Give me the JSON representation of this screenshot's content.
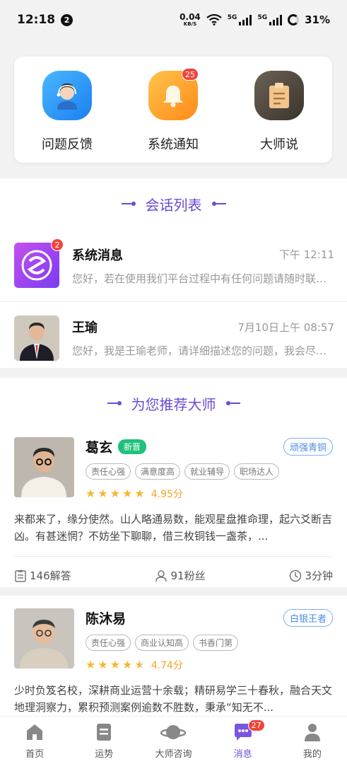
{
  "status_bar": {
    "time": "12:18",
    "notif_count": "2",
    "net_speed_value": "0.04",
    "net_speed_unit": "KB/S",
    "sim1": "5G",
    "sim2": "5G",
    "battery": "31%"
  },
  "quick_actions": [
    {
      "label": "问题反馈",
      "icon": "customer-service-icon"
    },
    {
      "label": "系统通知",
      "icon": "bell-icon",
      "badge": "25"
    },
    {
      "label": "大师说",
      "icon": "clipboard-icon"
    }
  ],
  "conversations": {
    "title": "会话列表",
    "items": [
      {
        "name": "系统消息",
        "time": "下午 12:11",
        "message": "您好，若在使用我们平台过程中有任何问题请随时联系我们",
        "badge": "2"
      },
      {
        "name": "王瑜",
        "time": "7月10日上午 08:57",
        "message": "您好，我是王瑜老师，请详细描述您的问题，我会尽快为您解答"
      }
    ]
  },
  "recommend": {
    "title": "为您推荐大师",
    "masters": [
      {
        "name": "葛玄",
        "new_badge": "新晋",
        "rank": "顽强青铜",
        "tags": [
          "责任心强",
          "满意度高",
          "就业辅导",
          "职场达人"
        ],
        "rating": 4.95,
        "score_text": "4.95分",
        "description": "来都来了，缘分使然。山人略通易数，能观星盘推命理，起六爻断吉凶。有甚迷惘？不妨坐下聊聊，借三枚铜钱一盏茶，...",
        "answers": "146解答",
        "fans": "91粉丝",
        "response": "3分钟"
      },
      {
        "name": "陈沐易",
        "rank": "白银王者",
        "tags": [
          "责任心强",
          "商业认知高",
          "书香门第"
        ],
        "rating": 4.74,
        "score_text": "4.74分",
        "description": "少时负笈名校，深耕商业运营十余载；精研易学三十春秋，融合天文地理洞察力，累积预测案例逾数不胜数，秉承“知无不..."
      }
    ]
  },
  "bottom_nav": [
    {
      "label": "首页",
      "icon": "home-icon"
    },
    {
      "label": "运势",
      "icon": "document-icon"
    },
    {
      "label": "大师咨询",
      "icon": "planet-icon"
    },
    {
      "label": "消息",
      "icon": "message-icon",
      "badge": "27",
      "active": true
    },
    {
      "label": "我的",
      "icon": "profile-icon"
    }
  ],
  "colors": {
    "accent": "#6a4bd6",
    "badge": "#f0453b",
    "star": "#f5b82e",
    "new": "#1fc17b",
    "rank": "#4a8de8"
  }
}
